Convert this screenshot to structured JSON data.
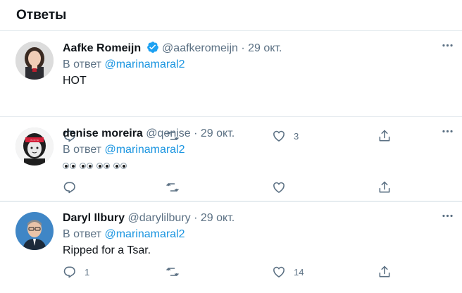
{
  "header": {
    "title": "Ответы"
  },
  "tweets": [
    {
      "name": "Aafke Romeijn",
      "verified": true,
      "handle": "@aafkeromeijn",
      "dot": "·",
      "date": "29 окт.",
      "reply_prefix": "В ответ",
      "reply_mention": "@marinamaral2",
      "text": "HOT",
      "reply_count": "",
      "retweet_count": "",
      "like_count": "3"
    },
    {
      "name": "denise moreira",
      "verified": false,
      "handle": "@qenise",
      "dot": "·",
      "date": "29 окт.",
      "reply_prefix": "В ответ",
      "reply_mention": "@marinamaral2",
      "text": "",
      "emoji": "eyes",
      "emoji_count": 4,
      "reply_count": "",
      "retweet_count": "",
      "like_count": ""
    },
    {
      "name": "Daryl Ilbury",
      "verified": false,
      "handle": "@darylilbury",
      "dot": "·",
      "date": "29 окт.",
      "reply_prefix": "В ответ",
      "reply_mention": "@marinamaral2",
      "text": "Ripped for a Tsar.",
      "reply_count": "1",
      "retweet_count": "",
      "like_count": "14"
    }
  ],
  "icons": {
    "more": "more-icon",
    "reply": "reply-icon",
    "retweet": "retweet-icon",
    "like": "heart-icon",
    "share": "share-icon",
    "verified": "verified-badge-icon"
  },
  "colors": {
    "text": "#0f1419",
    "secondary": "#5b7083",
    "link": "#1b95e0",
    "verified": "#1da1f2",
    "divider": "#e6ecf0"
  }
}
